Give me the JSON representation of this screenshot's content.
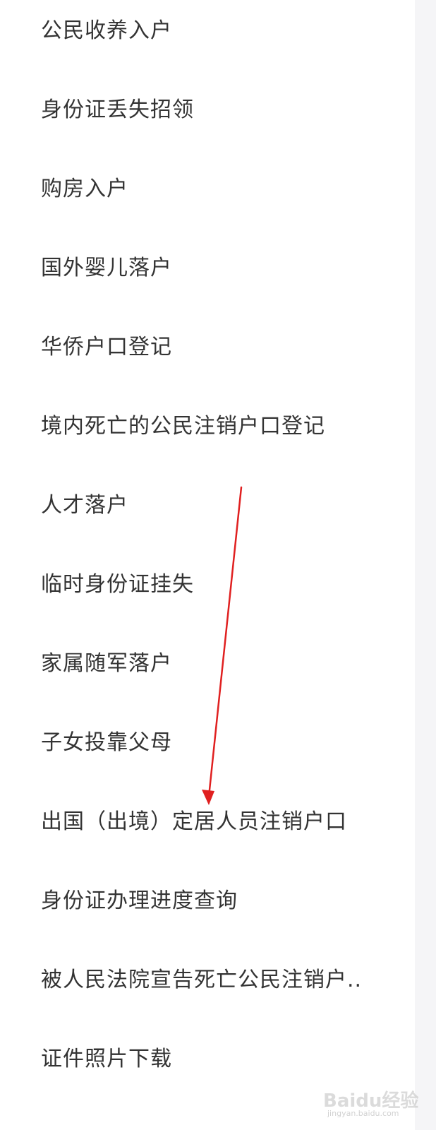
{
  "menu": {
    "items": [
      {
        "label": "公民收养入户"
      },
      {
        "label": "身份证丢失招领"
      },
      {
        "label": "购房入户"
      },
      {
        "label": "国外婴儿落户"
      },
      {
        "label": "华侨户口登记"
      },
      {
        "label": "境内死亡的公民注销户口登记"
      },
      {
        "label": "人才落户"
      },
      {
        "label": "临时身份证挂失"
      },
      {
        "label": "家属随军落户"
      },
      {
        "label": "子女投靠父母"
      },
      {
        "label": "出国（出境）定居人员注销户口"
      },
      {
        "label": "身份证办理进度查询"
      },
      {
        "label": "被人民法院宣告死亡公民注销户.."
      },
      {
        "label": "证件照片下载"
      }
    ]
  },
  "annotation": {
    "arrow_color": "#e02020"
  },
  "watermark": {
    "logo": "Baidu经验",
    "url": "jingyan.baidu.com"
  }
}
